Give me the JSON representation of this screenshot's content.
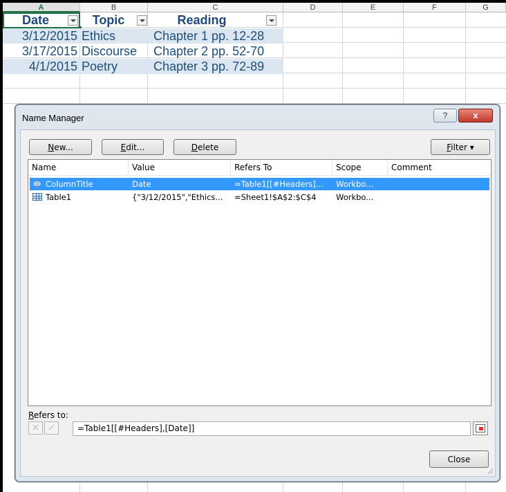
{
  "sheet": {
    "columns": [
      "A",
      "B",
      "C",
      "D",
      "E",
      "F",
      "G"
    ],
    "headers": {
      "date": "Date",
      "topic": "Topic",
      "reading": "Reading"
    },
    "rows": [
      {
        "date": "3/12/2015",
        "topic": "Ethics",
        "reading": "Chapter 1 pp. 12-28"
      },
      {
        "date": "3/17/2015",
        "topic": "Discourse",
        "reading": "Chapter 2 pp. 52-70"
      },
      {
        "date": "4/1/2015",
        "topic": "Poetry",
        "reading": "Chapter 3 pp. 72-89"
      }
    ]
  },
  "dialog": {
    "title": "Name Manager",
    "help_label": "?",
    "close_x": "x",
    "buttons": {
      "new_u": "N",
      "new_rest": "ew...",
      "edit_u": "E",
      "edit_rest": "dit...",
      "delete_u": "D",
      "delete_rest": "elete",
      "filter_u": "F",
      "filter_rest": "ilter ▾"
    },
    "list": {
      "columns": [
        "Name",
        "Value",
        "Refers To",
        "Scope",
        "Comment"
      ],
      "rows": [
        {
          "icon": "named-range-icon",
          "name": "ColumnTitle",
          "value": "Date",
          "refers_to": "=Table1[[#Headers]...",
          "scope": "Workbo...",
          "comment": "",
          "selected": true
        },
        {
          "icon": "table-icon",
          "name": "Table1",
          "value": "{\"3/12/2015\",\"Ethics...",
          "refers_to": "=Sheet1!$A$2:$C$4",
          "scope": "Workbo...",
          "comment": "",
          "selected": false
        }
      ]
    },
    "refers_to_label_u": "R",
    "refers_to_label_rest": "efers to:",
    "refers_to_value": "=Table1[[#Headers],[Date]]",
    "cancel_glyph": "✕",
    "confirm_glyph": "✓",
    "close_button": "Close"
  }
}
